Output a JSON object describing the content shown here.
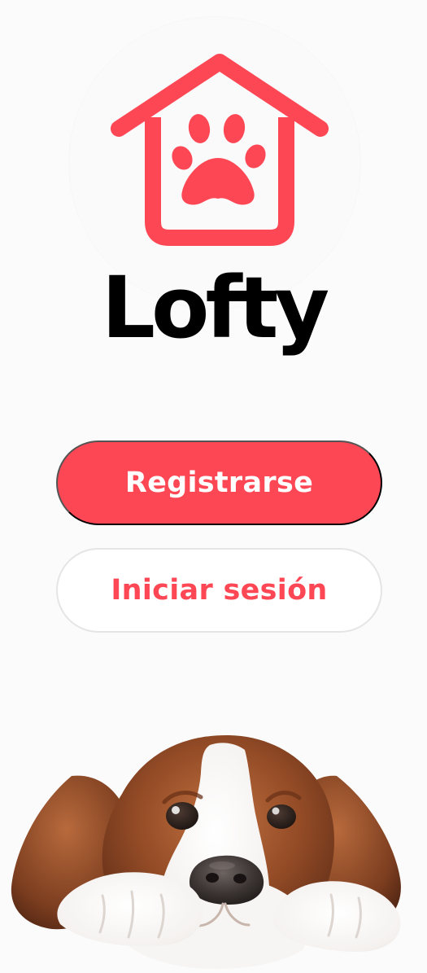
{
  "brand": {
    "name": "Lofty",
    "logo_icon": "house-paw-icon",
    "accent_color": "#fe4755",
    "text_color": "#000000"
  },
  "actions": {
    "register_label": "Registrarse",
    "login_label": "Iniciar sesión"
  },
  "hero_image": {
    "icon": "dog-illustration"
  }
}
